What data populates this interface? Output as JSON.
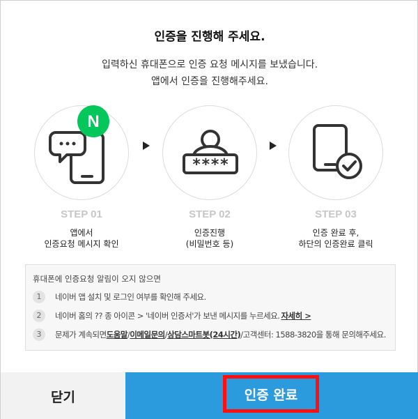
{
  "dialog": {
    "title": "인증을 진행해 주세요.",
    "desc_line1": "입력하신 휴대폰으로 인증 요청 메시지를 보냈습니다.",
    "desc_line2": "앱에서 인증을 진행해주세요."
  },
  "steps": [
    {
      "label": "STEP 01",
      "line1": "앱에서",
      "line2": "인증요청 메시지 확인",
      "icon": "phone-chat-naver-icon"
    },
    {
      "label": "STEP 02",
      "line1": "인증진행",
      "line2": "(비밀번호 등)",
      "icon": "password-user-icon",
      "mask": "****"
    },
    {
      "label": "STEP 03",
      "line1": "인증 완료 후,",
      "line2": "하단의 인증완료 클릭",
      "icon": "phone-check-icon"
    }
  ],
  "naver_badge": "N",
  "notice": {
    "head": "휴대폰에 인증요청 알림이 오지 않으면",
    "items": [
      {
        "num": "1",
        "text": "네이버 앱 설치 및 로그인 여부를 확인해 주세요."
      },
      {
        "num": "2",
        "text_a": "네이버 홈의 ?? 종 아이콘 > '네이버 인증서'가 보낸 메시지를 누르세요.",
        "link": "자세히 >"
      },
      {
        "num": "3",
        "text_a": "문제가 계속되면 ",
        "link1": "도움말",
        "sep1": "/",
        "link2": "이메일문의",
        "sep2": "/",
        "link3": "상담스마트봇(24시간)",
        "text_b": "/고객센터: 1588-3820을 통해 문의해주세요."
      }
    ]
  },
  "buttons": {
    "close": "닫기",
    "confirm": "인증 완료"
  },
  "colors": {
    "accent_blue": "#2b9bdd",
    "naver_green": "#03c75a",
    "highlight_red": "#ff1010"
  }
}
